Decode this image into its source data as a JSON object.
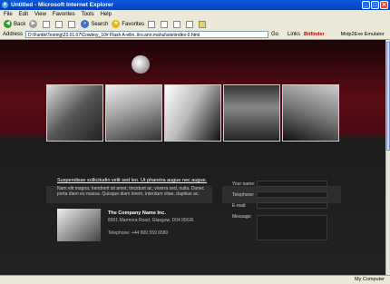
{
  "window": {
    "title": "Untitled - Microsoft Internet Explorer",
    "controls": [
      "_",
      "□",
      "✕"
    ]
  },
  "menu": [
    "File",
    "Edit",
    "View",
    "Favorites",
    "Tools",
    "Help"
  ],
  "toolbar": {
    "back": "Back",
    "search": "Search",
    "favorites": "Favorites"
  },
  "address": {
    "label": "Address",
    "url": "D:\\Funtik\\Testing\\23.01.07\\Cowboy_10# Flash A-ellin..llro.ann.mahul\\site\\index-0.html",
    "go": "Go",
    "links": "Links",
    "ext": "Bitfinder",
    "midp": "Midp2Exe Emulator"
  },
  "site": {
    "headline": "Suspendisse sollicitudin velit sed leo. Ut pharetra augue nec augue.",
    "body": "Nam elit magna, hendrerit sit amet, tincidunt ac, viverra sed, nulla. Donec porta diam eu massa. Quisque diam lorem, interdum vitae, dapibus ac.",
    "company_name": "The Company Name Inc.",
    "company_address": "8901 Marmora Road, Glasgow, D04 89GR.",
    "company_phone": "Telephone:    +44 800 559 6580",
    "form": {
      "name": "Your name:",
      "telephone": "Telephone:",
      "email": "E-mail:",
      "message": "Message:"
    }
  },
  "status": {
    "zone": "My Computer"
  }
}
